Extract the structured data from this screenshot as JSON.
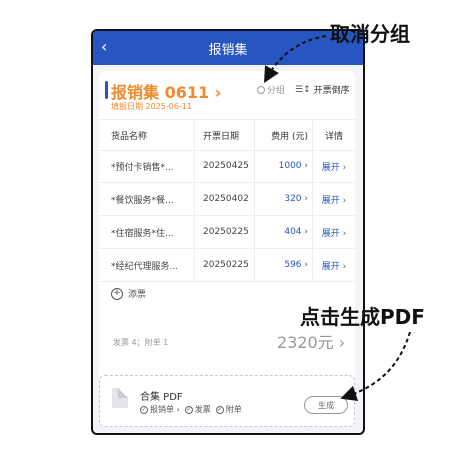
{
  "header": {
    "back_icon": "chevron-left-icon",
    "back_glyph": "‹",
    "title": "报销集"
  },
  "set": {
    "name": "报销集 0611",
    "chevron": "›",
    "date_label": "填报日期 2025-06-11",
    "group_toggle": "分组",
    "sort_label": "开票倒序",
    "sort_glyph": "☰↕"
  },
  "table": {
    "headers": [
      "货品名称",
      "开票日期",
      "费用 (元)",
      "详情"
    ],
    "rows": [
      {
        "name": "*预付卡销售*...",
        "date": "20250425",
        "amount": "1000 ›",
        "action": "展开 ›"
      },
      {
        "name": "*餐饮服务*餐...",
        "date": "20250402",
        "amount": "320 ›",
        "action": "展开 ›"
      },
      {
        "name": "*住宿服务*住...",
        "date": "20250225",
        "amount": "404 ›",
        "action": "展开 ›"
      },
      {
        "name": "*经纪代理服务...",
        "date": "20250225",
        "amount": "596 ›",
        "action": "展开 ›"
      }
    ]
  },
  "add": {
    "plus": "+",
    "label": "添票"
  },
  "summary": {
    "counts": "发票 4；附单 1",
    "total": "2320元 ›"
  },
  "pdf": {
    "name": "合集 PDF",
    "options": [
      "报销单 ›",
      "发票",
      "附单"
    ],
    "check_glyph": "✓",
    "generate_label": "生成"
  },
  "annotations": {
    "cancel_group": "取消分组",
    "click_generate": "点击生成PDF"
  },
  "colors": {
    "primary": "#2756c2",
    "accent_orange": "#f08a2e"
  }
}
